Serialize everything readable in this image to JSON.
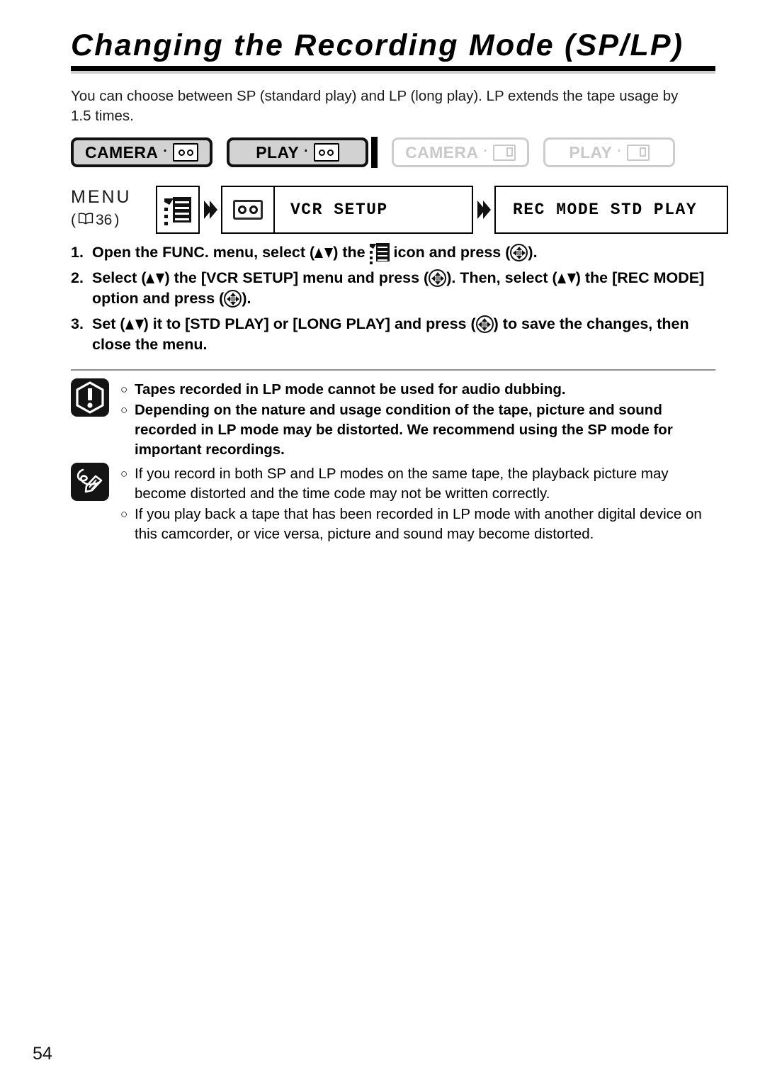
{
  "document": {
    "title": "Changing the Recording Mode (SP/LP)",
    "intro": "You can choose between SP (standard play) and LP (long play). LP extends the tape usage by 1.5 times.",
    "page_number": "54"
  },
  "mode_badges": [
    {
      "label": "CAMERA",
      "separator": "·",
      "media_icon": "tape-icon",
      "state": "active"
    },
    {
      "label": "PLAY",
      "separator": "·",
      "media_icon": "tape-icon",
      "state": "active"
    },
    {
      "label": "CAMERA",
      "separator": "·",
      "media_icon": "card-icon",
      "state": "inactive"
    },
    {
      "label": "PLAY",
      "separator": "·",
      "media_icon": "card-icon",
      "state": "inactive"
    }
  ],
  "menu_flow": {
    "label": "MENU",
    "reference": "36",
    "reference_open": "(",
    "reference_close": ")",
    "reference_icon": "book-icon",
    "menu_icon": "menu-list-icon",
    "arrow_icon": "double-chevron-right-icon",
    "vcr_setup": {
      "icon": "tape-icon",
      "text": "VCR SETUP"
    },
    "rec_mode": {
      "text": "REC MODE STD PLAY"
    }
  },
  "steps": [
    {
      "number": "1.",
      "parts": [
        {
          "type": "text",
          "value": "Open the FUNC. menu, select ("
        },
        {
          "type": "icon",
          "value": "updown-icon"
        },
        {
          "type": "text",
          "value": ") the "
        },
        {
          "type": "icon",
          "value": "menu-list-icon"
        },
        {
          "type": "text",
          "value": " icon and press ("
        },
        {
          "type": "icon",
          "value": "joystick-icon"
        },
        {
          "type": "text",
          "value": ")."
        }
      ]
    },
    {
      "number": "2.",
      "parts": [
        {
          "type": "text",
          "value": "Select ("
        },
        {
          "type": "icon",
          "value": "updown-icon"
        },
        {
          "type": "text",
          "value": ") the [VCR SETUP] menu and press ("
        },
        {
          "type": "icon",
          "value": "joystick-icon"
        },
        {
          "type": "text",
          "value": "). Then, select ("
        },
        {
          "type": "icon",
          "value": "updown-icon"
        },
        {
          "type": "text",
          "value": ") the [REC MODE] option and press ("
        },
        {
          "type": "icon",
          "value": "joystick-icon"
        },
        {
          "type": "text",
          "value": ")."
        }
      ]
    },
    {
      "number": "3.",
      "parts": [
        {
          "type": "text",
          "value": "Set ("
        },
        {
          "type": "icon",
          "value": "updown-icon"
        },
        {
          "type": "text",
          "value": ") it to [STD PLAY] or [LONG PLAY] and press ("
        },
        {
          "type": "icon",
          "value": "joystick-icon"
        },
        {
          "type": "text",
          "value": ") to save the changes, then close the menu."
        }
      ]
    }
  ],
  "warning": {
    "icon": "exclamation-hexagon-icon",
    "bullet": "○",
    "items": [
      "Tapes recorded in LP mode cannot be used for audio dubbing.",
      "Depending on the nature and usage condition of the tape, picture and sound recorded in LP mode may be distorted. We recommend using the SP mode for important recordings."
    ]
  },
  "notes": {
    "icon": "pencil-note-icon",
    "bullet": "○",
    "items": [
      "If you record in both SP and LP modes on the same tape, the playback picture may become distorted and the time code may not be written correctly.",
      "If you play back a tape that has been recorded in LP mode with another digital device on this camcorder, or vice versa, picture and sound may become distorted."
    ]
  },
  "colors": {
    "ink": "#000000",
    "badge_active_fill": "#d2d2d2",
    "badge_inactive": "#c9c9c9",
    "divider": "#8d8d8d",
    "joystick_center": "#8c8c8c"
  }
}
